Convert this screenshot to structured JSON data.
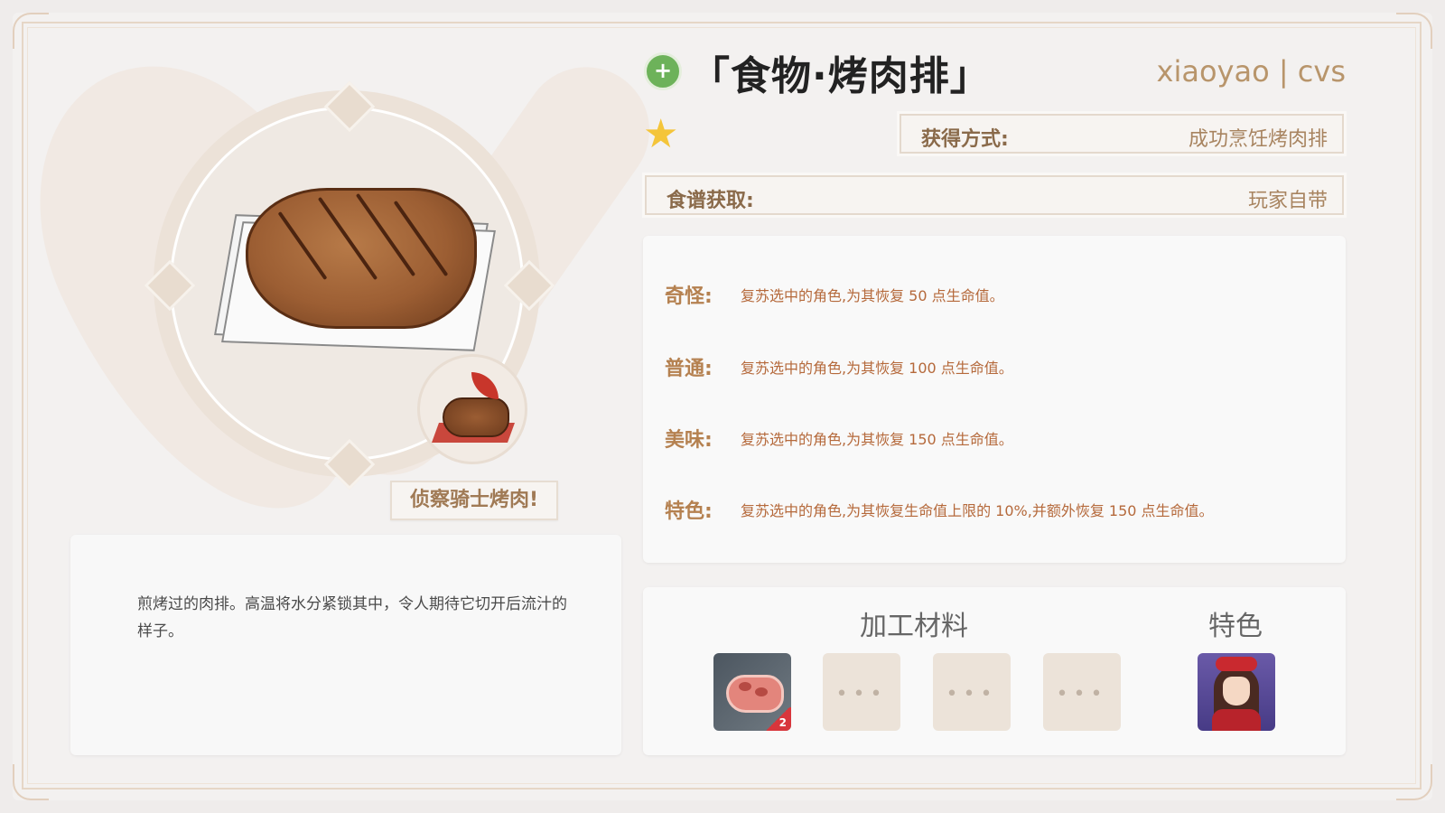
{
  "header": {
    "title": "「食物·烤肉排」",
    "author": "xiaoyao | cvs",
    "icon": "healing-food-icon",
    "rarity_stars": 1
  },
  "info": {
    "obtain_label": "获得方式:",
    "obtain_value": "成功烹饪烤肉排",
    "recipe_label": "食谱获取:",
    "recipe_value": "玩家自带"
  },
  "effects": [
    {
      "label": "奇怪:",
      "text": "复苏选中的角色,为其恢复 50 点生命值。"
    },
    {
      "label": "普通:",
      "text": "复苏选中的角色,为其恢复 100 点生命值。"
    },
    {
      "label": "美味:",
      "text": "复苏选中的角色,为其恢复 150 点生命值。"
    },
    {
      "label": "特色:",
      "text": "复苏选中的角色,为其恢复生命值上限的 10%,并额外恢复 150 点生命值。"
    }
  ],
  "special_dish": {
    "name": "侦察骑士烤肉!"
  },
  "description": "煎烤过的肉排。高温将水分紧锁其中，令人期待它切开后流汁的样子。",
  "materials": {
    "title": "加工材料",
    "items": [
      {
        "name": "raw-meat",
        "count": "2"
      },
      {
        "name": "empty",
        "placeholder": "•••"
      },
      {
        "name": "empty",
        "placeholder": "•••"
      },
      {
        "name": "empty",
        "placeholder": "•••"
      }
    ]
  },
  "special": {
    "title": "特色",
    "character": "character-avatar"
  },
  "colors": {
    "accent": "#b58150",
    "star": "#f4c53a",
    "effect_text": "#b5693b"
  }
}
